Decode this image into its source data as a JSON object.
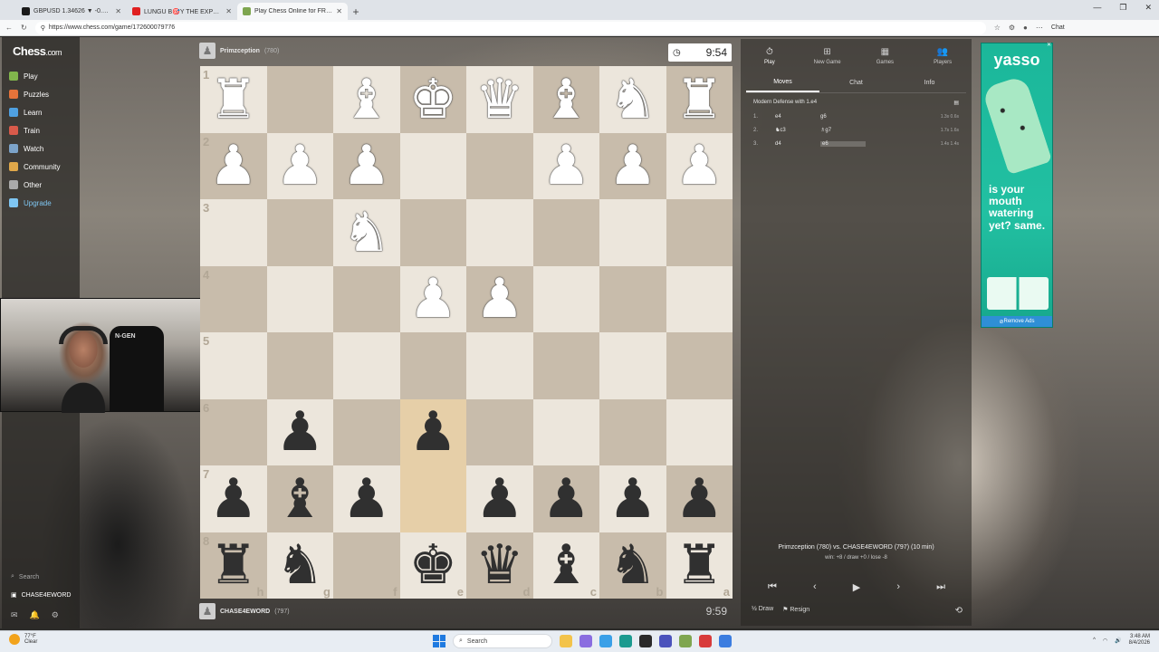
{
  "browser": {
    "tabs": [
      {
        "title": "GBPUSD 1.34626 ▼ -0.04% $100...",
        "color": "#1a1a1a",
        "active": false
      },
      {
        "title": "LUNGU B🎯Y THE EXPERIENCE",
        "color": "#e02020",
        "active": false
      },
      {
        "title": "Play Chess Online for FREE ...",
        "color": "#7fa650",
        "active": true
      }
    ],
    "new_tab": "+",
    "url": "https://www.chess.com/game/172600079776",
    "chat_label": "Chat"
  },
  "sidebar": {
    "logo": "Chess",
    "logo_suffix": ".com",
    "items": [
      {
        "label": "Play",
        "icon": "play-icon",
        "color": "#81b64c"
      },
      {
        "label": "Puzzles",
        "icon": "puzzle-icon",
        "color": "#e5733a"
      },
      {
        "label": "Learn",
        "icon": "learn-icon",
        "color": "#4fa0e0"
      },
      {
        "label": "Train",
        "icon": "train-icon",
        "color": "#d85a4a"
      },
      {
        "label": "Watch",
        "icon": "watch-icon",
        "color": "#7ca3c9"
      },
      {
        "label": "Community",
        "icon": "community-icon",
        "color": "#e0a84a"
      },
      {
        "label": "Other",
        "icon": "more-icon",
        "color": "#aaaaaa"
      },
      {
        "label": "Upgrade",
        "icon": "diamond-icon",
        "color": "#7fc6f2"
      }
    ],
    "search": "Search",
    "username": "CHASE4EWORD"
  },
  "top_player": {
    "name": "Primzception",
    "rating": "(780)"
  },
  "bottom_player": {
    "name": "CHASE4EWORD",
    "rating": "(797)"
  },
  "top_clock": "9:54",
  "bottom_clock": "9:59",
  "board": {
    "ranks": [
      "1",
      "2",
      "3",
      "4",
      "5",
      "6",
      "7",
      "8"
    ],
    "files": [
      "h",
      "g",
      "f",
      "e",
      "d",
      "c",
      "b",
      "a"
    ],
    "rows": [
      [
        "wR",
        "",
        "wB",
        "wK",
        "wQ",
        "wB",
        "wN",
        "wR"
      ],
      [
        "wP",
        "wP",
        "wP",
        "",
        "",
        "wP",
        "wP",
        "wP"
      ],
      [
        "",
        "",
        "wN",
        "",
        "",
        "",
        "",
        ""
      ],
      [
        "",
        "",
        "",
        "wP",
        "wP",
        "",
        "",
        ""
      ],
      [
        "",
        "",
        "",
        "",
        "",
        "",
        "",
        ""
      ],
      [
        "",
        "bP",
        "",
        "bP",
        "",
        "",
        "",
        ""
      ],
      [
        "bP",
        "bB",
        "bP",
        "",
        "bP",
        "bP",
        "bP",
        "bP"
      ],
      [
        "bR",
        "bN",
        "",
        "bK",
        "bQ",
        "bB",
        "bN",
        "bR"
      ]
    ],
    "highlight": [
      [
        5,
        3
      ],
      [
        6,
        3
      ]
    ]
  },
  "panel": {
    "top_tabs": [
      {
        "label": "Play",
        "icon": "clock-icon",
        "active": true
      },
      {
        "label": "New Game",
        "icon": "plus-icon",
        "active": false
      },
      {
        "label": "Games",
        "icon": "games-icon",
        "active": false
      },
      {
        "label": "Players",
        "icon": "players-icon",
        "active": false
      }
    ],
    "sub_tabs": [
      {
        "label": "Moves",
        "active": true
      },
      {
        "label": "Chat",
        "active": false
      },
      {
        "label": "Info",
        "active": false
      }
    ],
    "opening": "Modern Defense with 1.e4",
    "moves": [
      {
        "num": "1.",
        "white": "e4",
        "black": "g6",
        "times": "1.3s  0.6s"
      },
      {
        "num": "2.",
        "white": "♞c3",
        "black": "♗g7",
        "times": "1.7s  1.6s"
      },
      {
        "num": "3.",
        "white": "d4",
        "black": "e6",
        "times": "1.4s  1.4s"
      }
    ],
    "game_title": "Primzception (780) vs. CHASE4EWORD (797) (10 min)",
    "game_stats": "win: +8 / draw +0 / lose -8",
    "draw_label": "Draw",
    "resign_label": "Resign"
  },
  "ad": {
    "brand": "yasso",
    "slogan": "is your mouth watering yet? same.",
    "remove_label": "Remove Ads"
  },
  "taskbar": {
    "temp": "77°F",
    "weather": "Clear",
    "search": "Search",
    "time": "3:48 AM",
    "date": "8/4/2026"
  }
}
